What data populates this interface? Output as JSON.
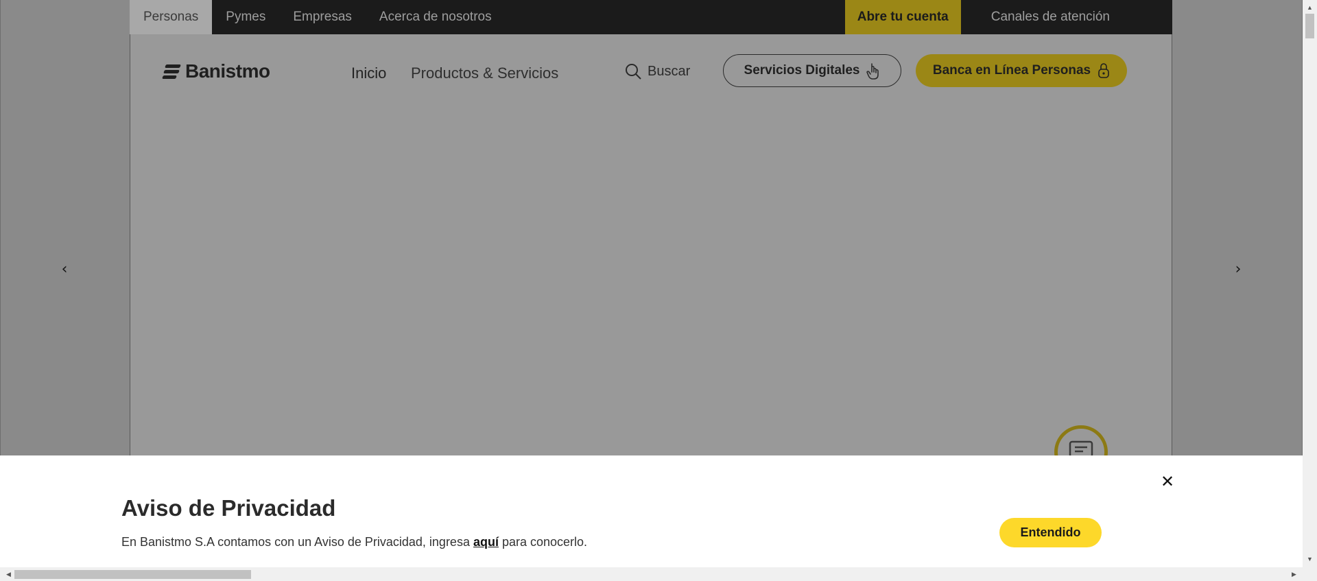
{
  "topbar": {
    "tabs": [
      "Personas",
      "Pymes",
      "Empresas",
      "Acerca de nosotros"
    ],
    "cta": "Abre tu cuenta",
    "support": "Canales de atención"
  },
  "header": {
    "logo": "Banistmo",
    "nav": [
      "Inicio",
      "Productos & Servicios"
    ],
    "search_label": "Buscar",
    "digital_services": "Servicios Digitales",
    "online_banking": "Banca en Línea Personas"
  },
  "carousel": {
    "prev_icon": "chevron-left-icon",
    "next_icon": "chevron-right-icon"
  },
  "privacy": {
    "title": "Aviso de Privacidad",
    "text_before": "En Banistmo S.A contamos con un Aviso de Privacidad, ingresa ",
    "link": "aquí",
    "text_after": " para conocerlo.",
    "accept": "Entendido",
    "close_symbol": "✕"
  },
  "colors": {
    "brand_yellow": "#fdd82a",
    "topbar_dark": "#1b1b1b"
  }
}
